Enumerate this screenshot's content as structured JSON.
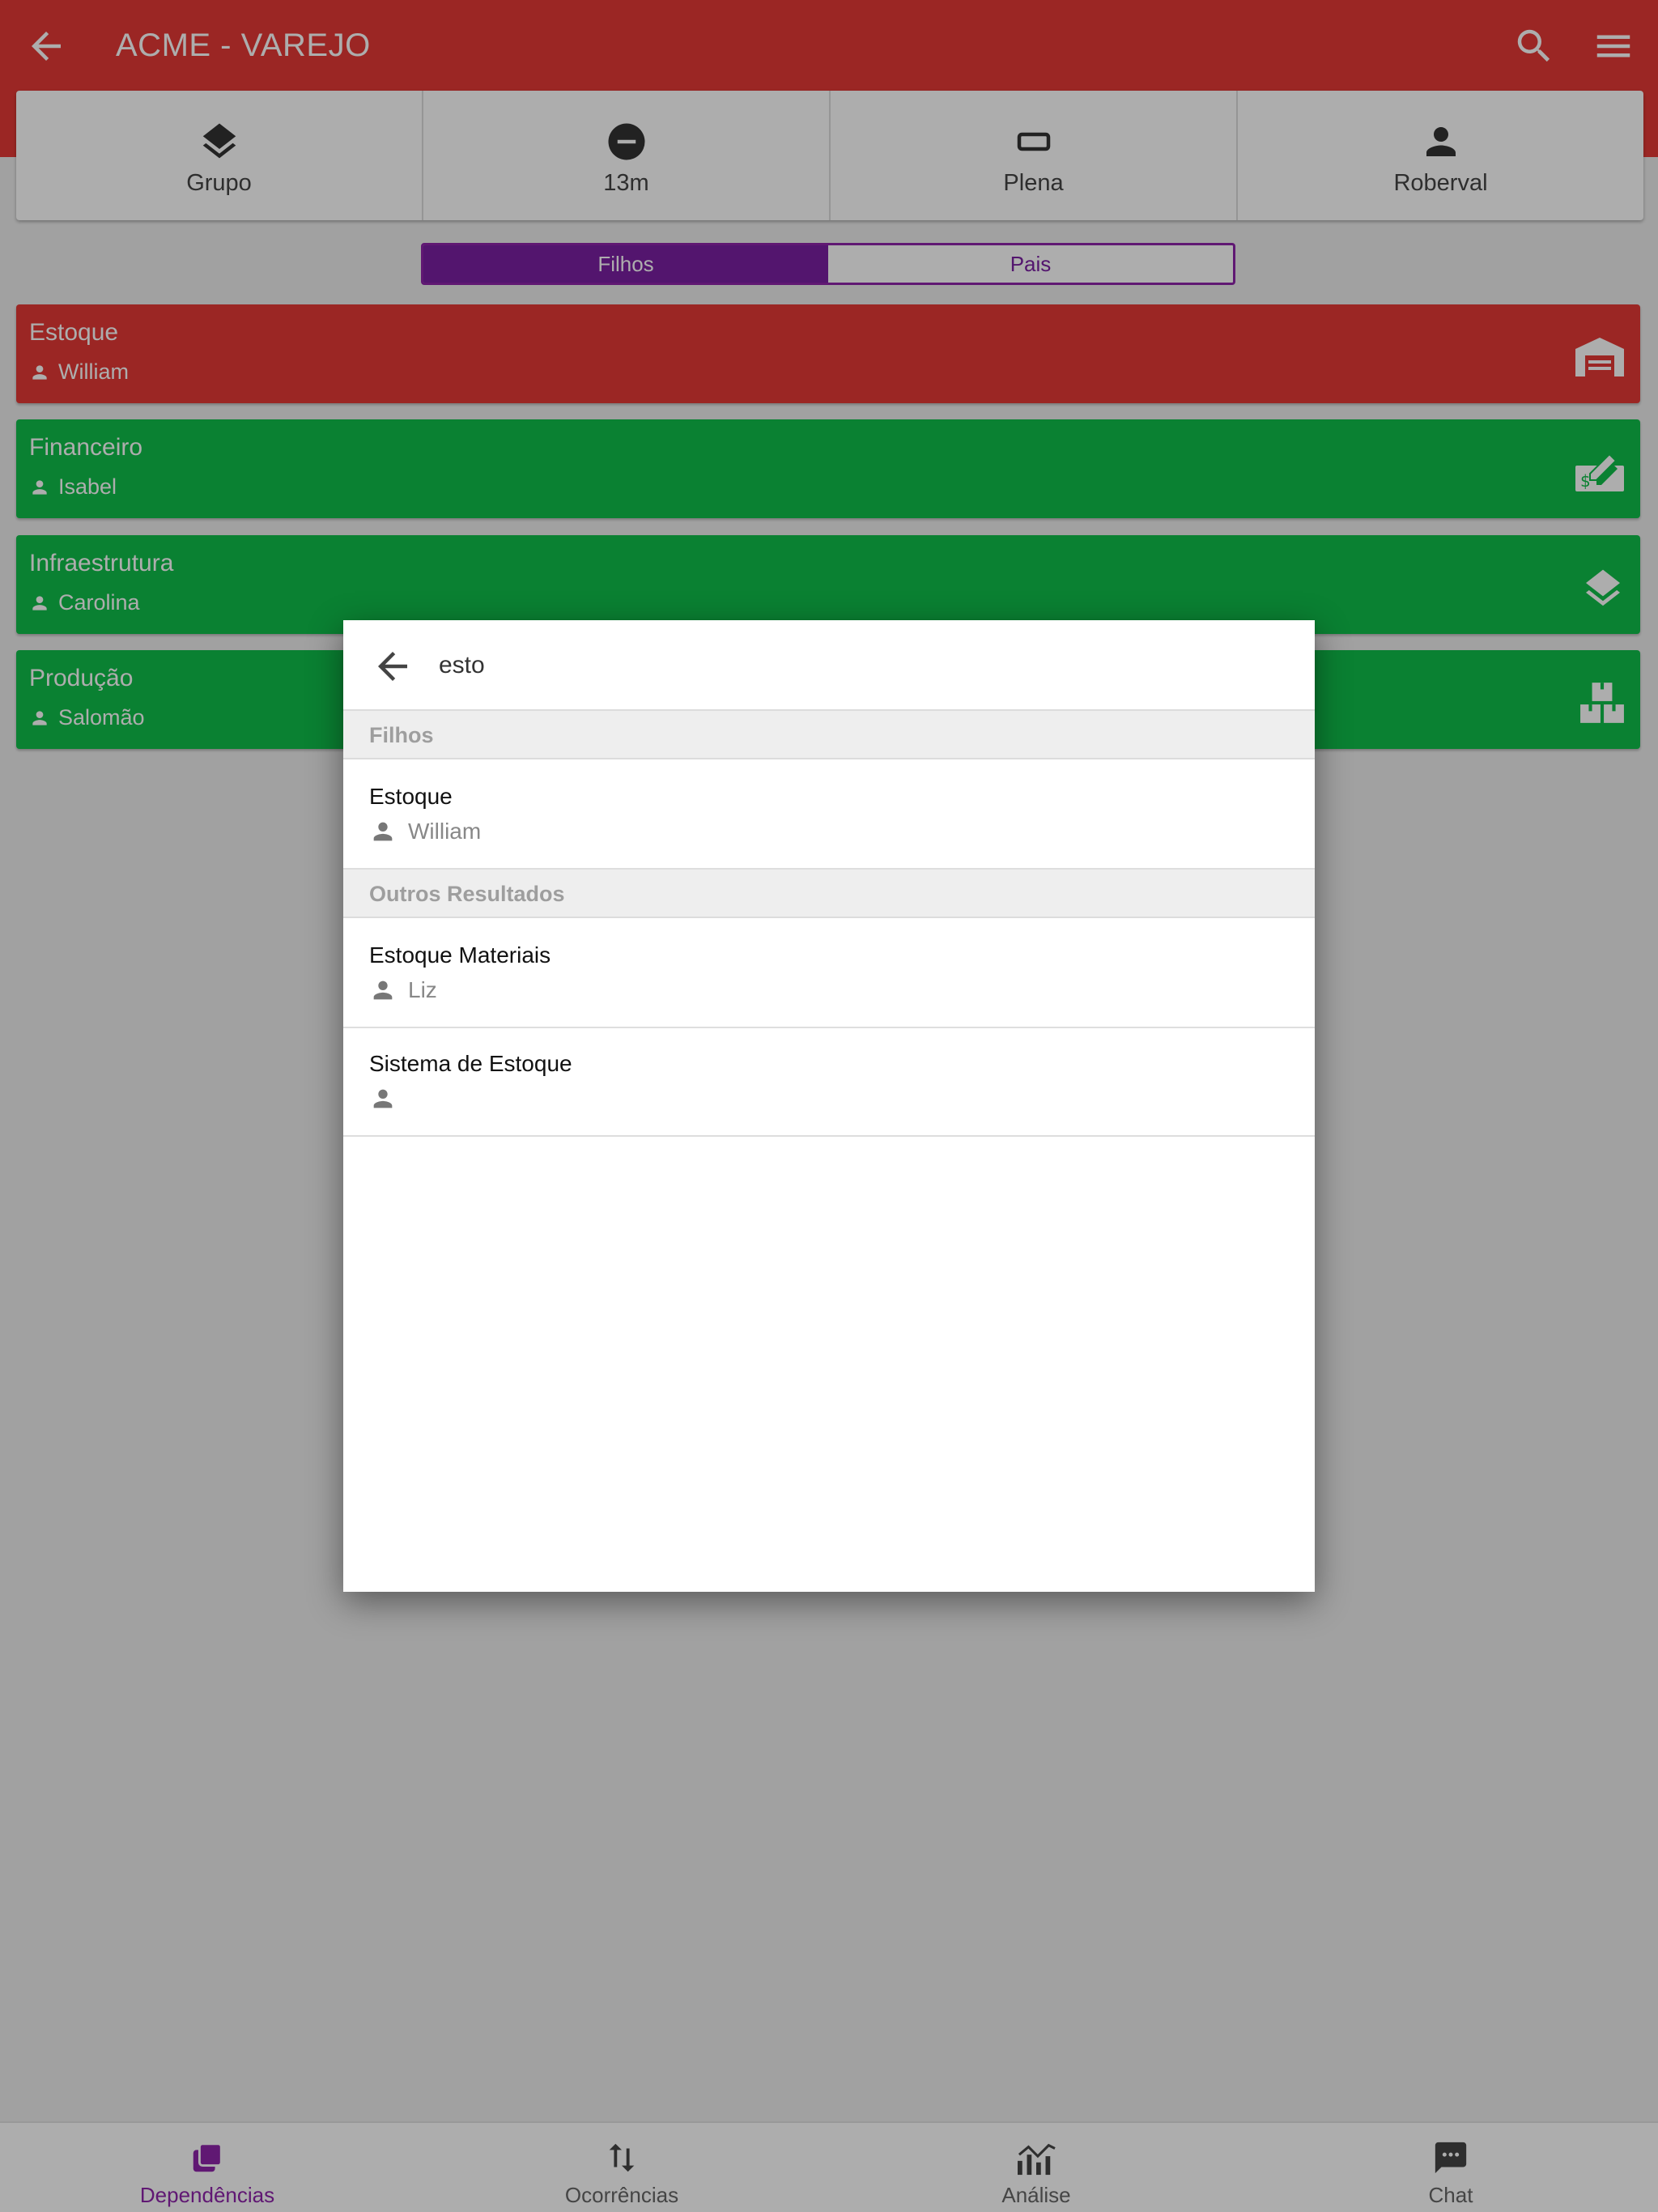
{
  "appbar": {
    "title": "ACME - VAREJO",
    "back_icon": "arrow-back-icon",
    "search_icon": "search-icon",
    "menu_icon": "menu-icon",
    "color": "#e53935"
  },
  "info": {
    "items": [
      {
        "icon": "layers-icon",
        "label": "Grupo"
      },
      {
        "icon": "minus-circle-icon",
        "label": "13m"
      },
      {
        "icon": "rectangle-icon",
        "label": "Plena"
      },
      {
        "icon": "person-icon",
        "label": "Roberval"
      }
    ]
  },
  "segment": {
    "left": "Filhos",
    "right": "Pais",
    "active": "Filhos",
    "color": "#7b1fa2"
  },
  "dependencies": [
    {
      "name": "Estoque",
      "owner": "William",
      "status_color": "#e53935",
      "icon": "warehouse-icon"
    },
    {
      "name": "Financeiro",
      "owner": "Isabel",
      "status_color": "#0fbf4a",
      "icon": "money-check-icon"
    },
    {
      "name": "Infraestrutura",
      "owner": "Carolina",
      "status_color": "#0fbf4a",
      "icon": "layers-icon"
    },
    {
      "name": "Produção",
      "owner": "Salomão",
      "status_color": "#0fbf4a",
      "icon": "boxes-icon"
    }
  ],
  "search_dialog": {
    "query": "esto",
    "back_icon": "arrow-back-icon",
    "sections": [
      {
        "title": "Filhos",
        "results": [
          {
            "name": "Estoque",
            "owner": "William"
          }
        ]
      },
      {
        "title": "Outros Resultados",
        "results": [
          {
            "name": "Estoque Materiais",
            "owner": "Liz"
          },
          {
            "name": "Sistema de Estoque",
            "owner": ""
          }
        ]
      }
    ]
  },
  "bottom_nav": {
    "items": [
      {
        "label": "Dependências",
        "icon": "dependencies-icon",
        "active": true
      },
      {
        "label": "Ocorrências",
        "icon": "sort-arrows-icon",
        "active": false
      },
      {
        "label": "Análise",
        "icon": "chart-icon",
        "active": false
      },
      {
        "label": "Chat",
        "icon": "chat-icon",
        "active": false
      }
    ],
    "active_color": "#8e24aa"
  }
}
